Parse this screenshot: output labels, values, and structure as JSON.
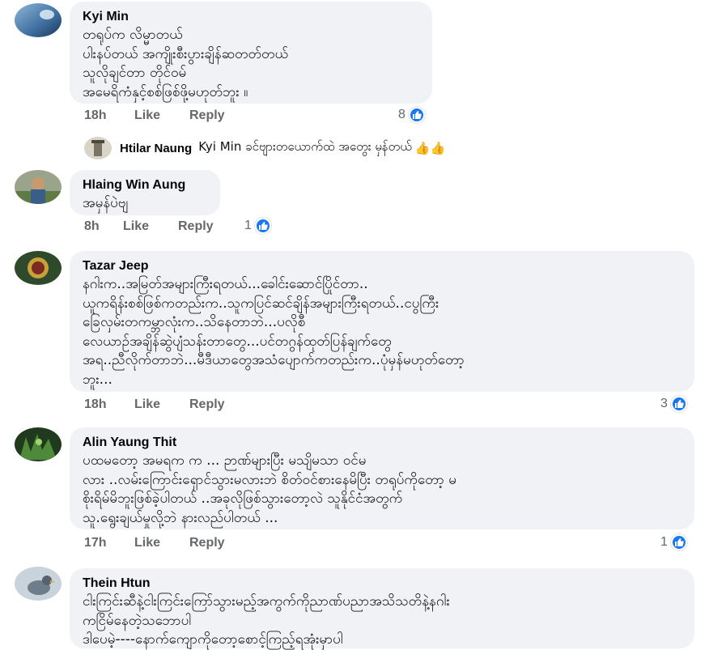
{
  "comments": [
    {
      "author": "Kyi Min",
      "text": "တရုပ်က လိမ္မာတယ်\nပါးနပ်တယ် အကျိုးစီးပွားချိန်ဆတတ်တယ်\n သူလိုချင်တာ တိုင်ဝမ်\nအမေရိကံနှင့်စစ်ဖြစ်ဖို့မဟုတ်ဘူး ။",
      "time": "18h",
      "like_label": "Like",
      "reply_label": "Reply",
      "reactions": "8"
    },
    {
      "author": "Hlaing Win Aung",
      "text": "အမှန်ပဲဗျ",
      "time": "8h",
      "like_label": "Like",
      "reply_label": "Reply",
      "reactions": "1"
    },
    {
      "author": "Tazar Jeep",
      "text": "နဂါးက..အမြတ်အများကြီးရတယ်...ခေါင်းဆောင်ပြိုင်တာ..\nယူကရိန်းစစ်ဖြစ်ကတည်းက..သူကပြင်ဆင်ချိန်အများကြီးရတယ်..ငပွကြီး\nခြေလှမ်းတကမ္ဘာလုံးက..သိနေတာဘဲ...ပလိုစီ\nလေယာဉ်အချိန်ဆွဲပျံသန်းတာတွေ...ပင်တဂွန်ထုတ်ပြန်ချက်တွေ\nအရ..ညီလိုက်တာဘဲ...မီဒီယာတွေအသံပျောက်ကတည်းက..ပုံမှန်မဟုတ်တော့\nဘူး...",
      "time": "18h",
      "like_label": "Like",
      "reply_label": "Reply",
      "reactions": "3"
    },
    {
      "author": "Alin Yaung Thit",
      "text": "ပထမတော့ အမရက က ...       ဉာဏ်များပြီး မသျိမသာ ဝင်မ\nလား ..လမ်းကြောင်းရှောင်သွားမလားဘဲ စိတ်ဝင်စားနေမိပြီး တရုပ်ကိုတော့ မ\nစိုးရိမ်မိဘူးဖြစ်ခဲ့ပါတယ် ..အခုလိုဖြစ်သွားတော့လဲ သူနိုင်ငံအတွက်\nသူ.ရွေးချယ်မှုလို့ဘဲ နားလည်ပါတယ် ...",
      "time": "17h",
      "like_label": "Like",
      "reply_label": "Reply",
      "reactions": "1"
    },
    {
      "author": "Thein Htun",
      "text": "ငါးကြင်းဆီနဲ့ငါးကြင်းကြော်သွားမည့်အကွက်ကိုညာဏ်ပညာအသိသတိနဲ့နဂါး\nကငြိမ်နေတဲ့သဘောပါ\n     ဒါပေမဲ့----နောက်ကျောကိုတော့စောင့်ကြည့်ရအုံးမှာပါ"
    }
  ],
  "reply": {
    "author": "Htilar Naung",
    "text": "Kyi Min ခင်ဗျားတယောက်ထဲ အတွေး မှန်တယ်",
    "emoji": "👍👍"
  },
  "icons": {
    "reaction": "like-icon",
    "emoji": "thumbs-up-emoji"
  },
  "colors": {
    "bubble": "#f0f2f5",
    "meta": "#65676b",
    "like": "#1877f2"
  }
}
